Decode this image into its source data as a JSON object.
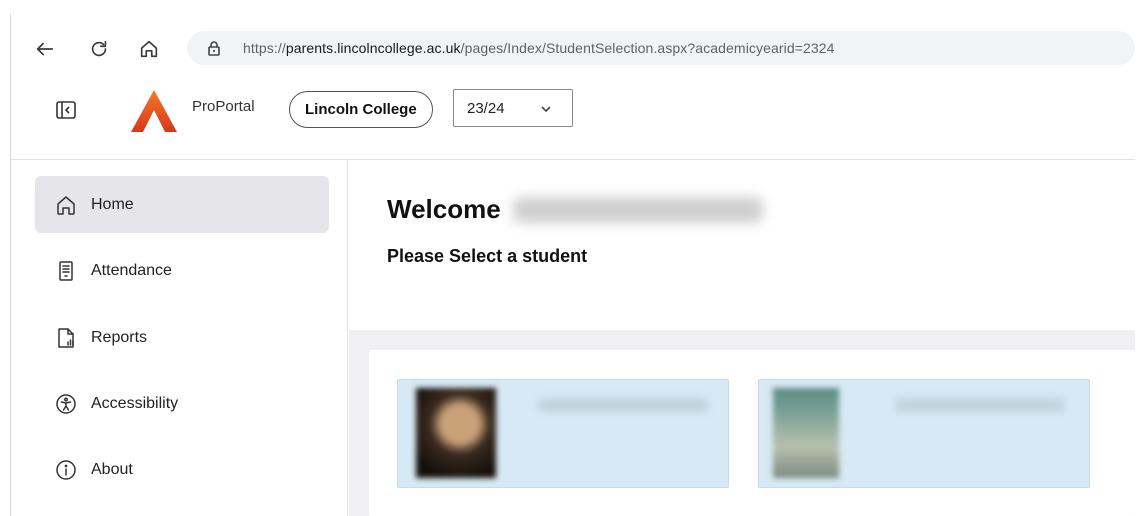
{
  "browser": {
    "url_prefix": "https://",
    "url_host": "parents.lincolncollege.ac.uk",
    "url_path": "/pages/Index/StudentSelection.aspx?academicyearid=2324"
  },
  "header": {
    "brand": "ProPortal",
    "college": "Lincoln College",
    "academic_year": "23/24",
    "logo_color": "#e8541c"
  },
  "sidebar": {
    "items": [
      {
        "label": "Home",
        "icon": "home-icon",
        "active": true
      },
      {
        "label": "Attendance",
        "icon": "attendance-icon"
      },
      {
        "label": "Reports",
        "icon": "reports-icon"
      },
      {
        "label": "Accessibility",
        "icon": "accessibility-icon"
      },
      {
        "label": "About",
        "icon": "info-icon"
      }
    ]
  },
  "main": {
    "welcome": "Welcome",
    "subtitle": "Please Select a student"
  },
  "colors": {
    "card_background": "#d7e9f5",
    "active_nav": "#e6e6ea",
    "content_background": "#f0f0f3"
  }
}
